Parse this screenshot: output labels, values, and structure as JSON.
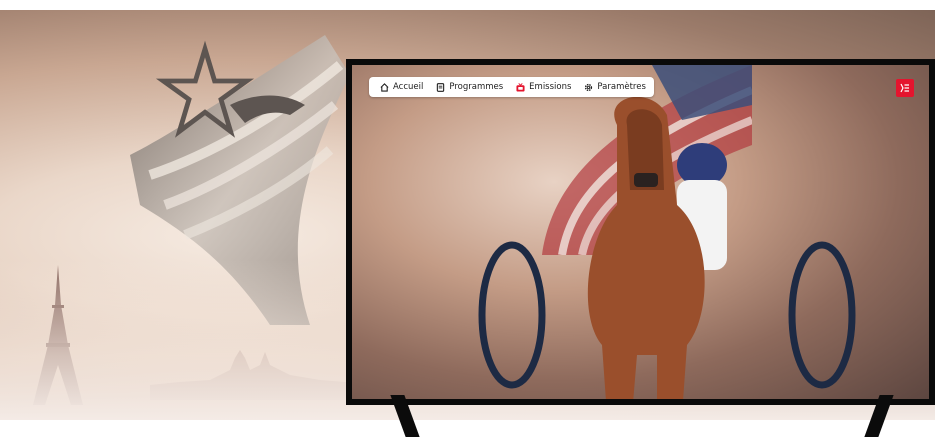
{
  "nav": {
    "items": [
      {
        "label": "Accueil",
        "icon": "home-icon"
      },
      {
        "label": "Programmes",
        "icon": "document-icon"
      },
      {
        "label": "Emissions",
        "icon": "tv-icon",
        "accent": "#e4142e"
      },
      {
        "label": "Paramètres",
        "icon": "gear-icon"
      }
    ]
  },
  "menu_button": {
    "icon": "menu-icon",
    "color": "#e4142e"
  },
  "colors": {
    "accent": "#e4142e",
    "tv_frame": "#0a0a0a",
    "nav_bg": "#ffffff"
  }
}
